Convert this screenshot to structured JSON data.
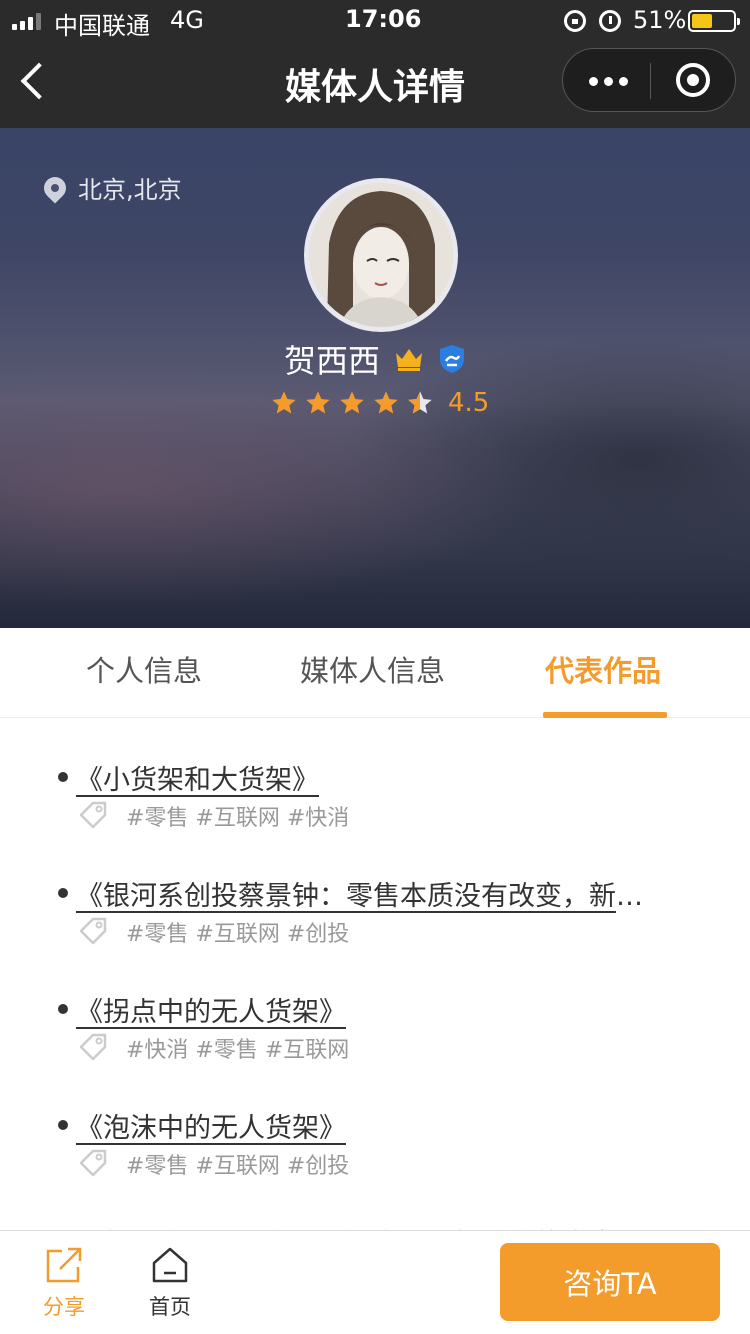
{
  "status_bar": {
    "carrier": "中国联通",
    "network": "4G",
    "time": "17:06",
    "battery": "51%",
    "battery_level": 0.51
  },
  "nav": {
    "title": "媒体人详情"
  },
  "profile": {
    "location": "北京,北京",
    "name": "贺西西",
    "rating": "4.5",
    "rating_value": 4.5,
    "rating_max": 5
  },
  "tabs": [
    {
      "label": "个人信息",
      "active": false
    },
    {
      "label": "媒体人信息",
      "active": false
    },
    {
      "label": "代表作品",
      "active": true
    }
  ],
  "works": [
    {
      "title": "《小货架和大货架》",
      "tags": "#零售 #互联网 #快消"
    },
    {
      "title": "《银河系创投蔡景钟：零售本质没有改变，新零售的关键是效率的提升》",
      "tags": "#零售 #互联网 #创投"
    },
    {
      "title": "《拐点中的无人货架》",
      "tags": "#快消 #零售 #互联网"
    },
    {
      "title": "《泡沫中的无人货架》",
      "tags": "#零售 #互联网 #创投"
    },
    {
      "title": "《新零售——门店是一渠道、传播融合的生意》",
      "tags": ""
    }
  ],
  "bottom_bar": {
    "share_label": "分享",
    "home_label": "首页",
    "consult_label": "咨询TA"
  },
  "colors": {
    "accent": "#f39b2b",
    "header_bg": "#2b2b2b",
    "verify_blue": "#2b7de0"
  }
}
